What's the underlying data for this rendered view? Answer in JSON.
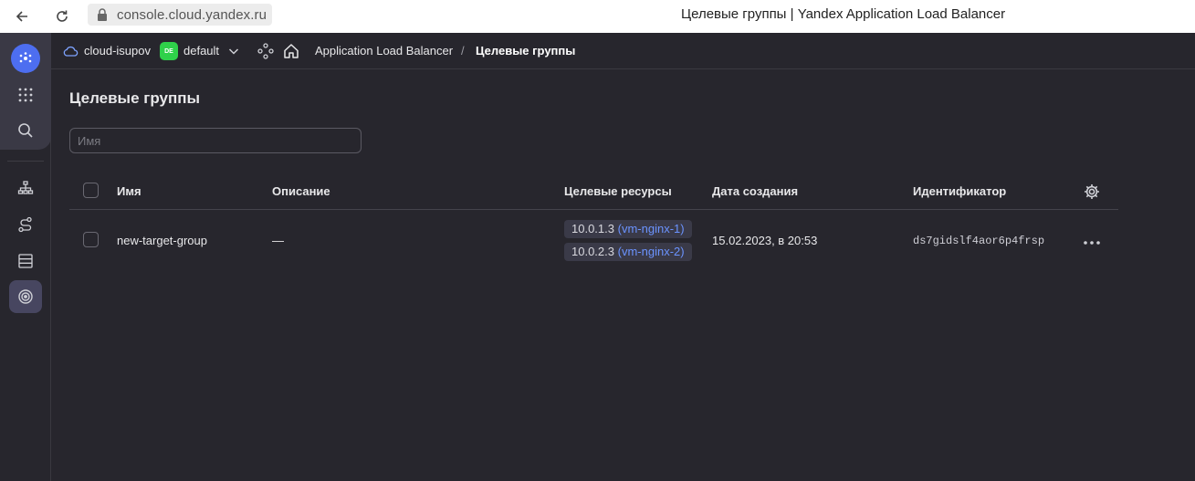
{
  "browser": {
    "url": "console.cloud.yandex.ru",
    "window_title": "Целевые группы | Yandex Application Load Balancer"
  },
  "header": {
    "cloud_name": "cloud-isupov",
    "folder_badge": "DE",
    "folder_name": "default",
    "breadcrumb": {
      "service": "Application Load Balancer",
      "separator": "/",
      "current": "Целевые группы"
    }
  },
  "page": {
    "title": "Целевые группы",
    "search_placeholder": "Имя"
  },
  "table": {
    "columns": {
      "name": "Имя",
      "description": "Описание",
      "resources": "Целевые ресурсы",
      "created": "Дата создания",
      "id": "Идентификатор"
    },
    "rows": [
      {
        "name": "new-target-group",
        "description": "—",
        "resources": [
          {
            "ip": "10.0.1.3",
            "vm": "(vm-nginx-1)"
          },
          {
            "ip": "10.0.2.3",
            "vm": "(vm-nginx-2)"
          }
        ],
        "created": "15.02.2023, в 20:53",
        "id": "ds7gidslf4aor6p4frsp"
      }
    ]
  },
  "colors": {
    "background": "#27262d",
    "accent": "#4d6ef0",
    "link": "#6b93ff",
    "folder_badge": "#2fd14a"
  },
  "icons": [
    "back-arrow-icon",
    "reload-icon",
    "lock-icon",
    "yc-logo-icon",
    "grid-icon",
    "search-icon",
    "network-icon",
    "route-icon",
    "storage-icon",
    "target-icon",
    "cloud-icon",
    "chevron-down-icon",
    "service-icon",
    "home-icon",
    "gear-icon",
    "more-icon"
  ]
}
